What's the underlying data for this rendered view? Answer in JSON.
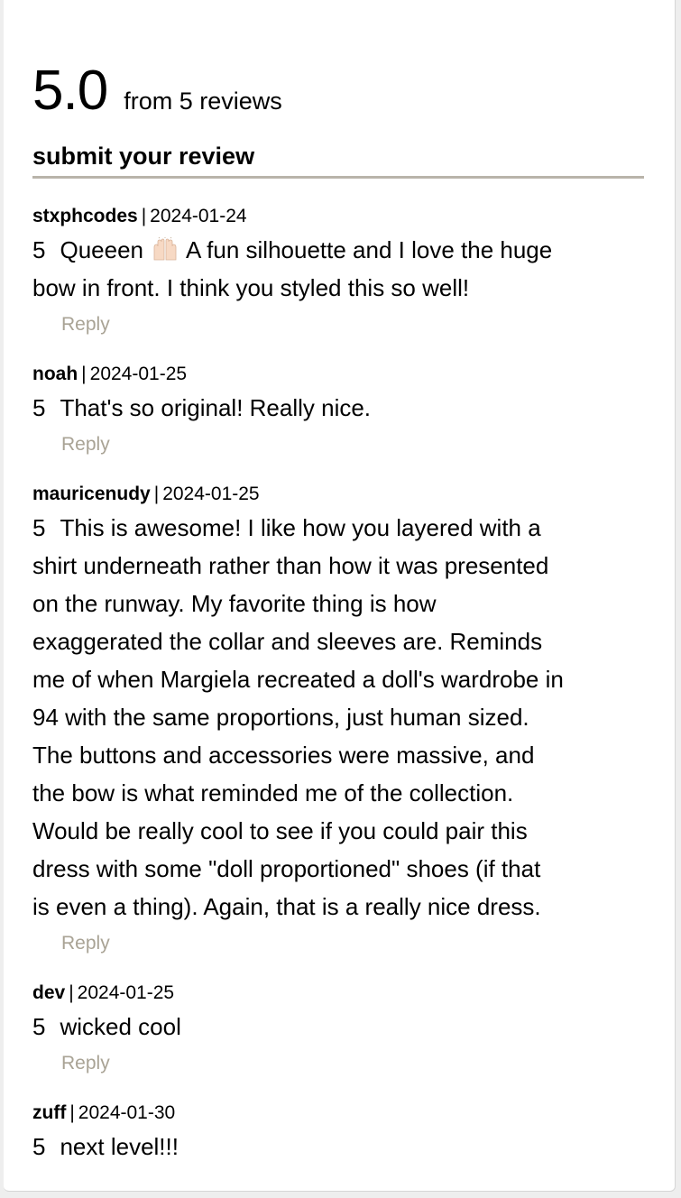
{
  "summary": {
    "rating": "5.0",
    "review_count_text": "from 5 reviews",
    "submit_label": "submit your review"
  },
  "reply_label": "Reply",
  "reviews": [
    {
      "user": "stxphcodes",
      "date": "2024-01-24",
      "stars": "5",
      "lines": [
        {
          "pre": "Queeen",
          "emoji": "raising-hands",
          "post": "A fun silhouette and I love the huge"
        },
        {
          "text": "bow in front. I think you styled this so well!"
        }
      ]
    },
    {
      "user": "noah",
      "date": "2024-01-25",
      "stars": "5",
      "lines": [
        {
          "text": "That's so original! Really nice."
        }
      ]
    },
    {
      "user": "mauricenudy",
      "date": "2024-01-25",
      "stars": "5",
      "lines": [
        {
          "text": "This is awesome! I like how you layered with a"
        },
        {
          "text": "shirt underneath rather than how it was presented"
        },
        {
          "text": "on the runway. My favorite thing is how"
        },
        {
          "text": "exaggerated the collar and sleeves are. Reminds"
        },
        {
          "text": "me of when Margiela recreated a doll's wardrobe in"
        },
        {
          "text": "94 with the same proportions, just human sized."
        },
        {
          "text": "The buttons and accessories were massive, and"
        },
        {
          "text": "the bow is what reminded me of the collection."
        },
        {
          "text": "Would be really cool to see if you could pair this"
        },
        {
          "text": "dress with some \"doll proportioned\" shoes (if that"
        },
        {
          "text": "is even a thing). Again, that is a really nice dress."
        }
      ]
    },
    {
      "user": "dev",
      "date": "2024-01-25",
      "stars": "5",
      "lines": [
        {
          "text": "wicked cool"
        }
      ]
    },
    {
      "user": "zuff",
      "date": "2024-01-30",
      "stars": "5",
      "lines": [
        {
          "text": "next level!!!"
        }
      ]
    }
  ]
}
